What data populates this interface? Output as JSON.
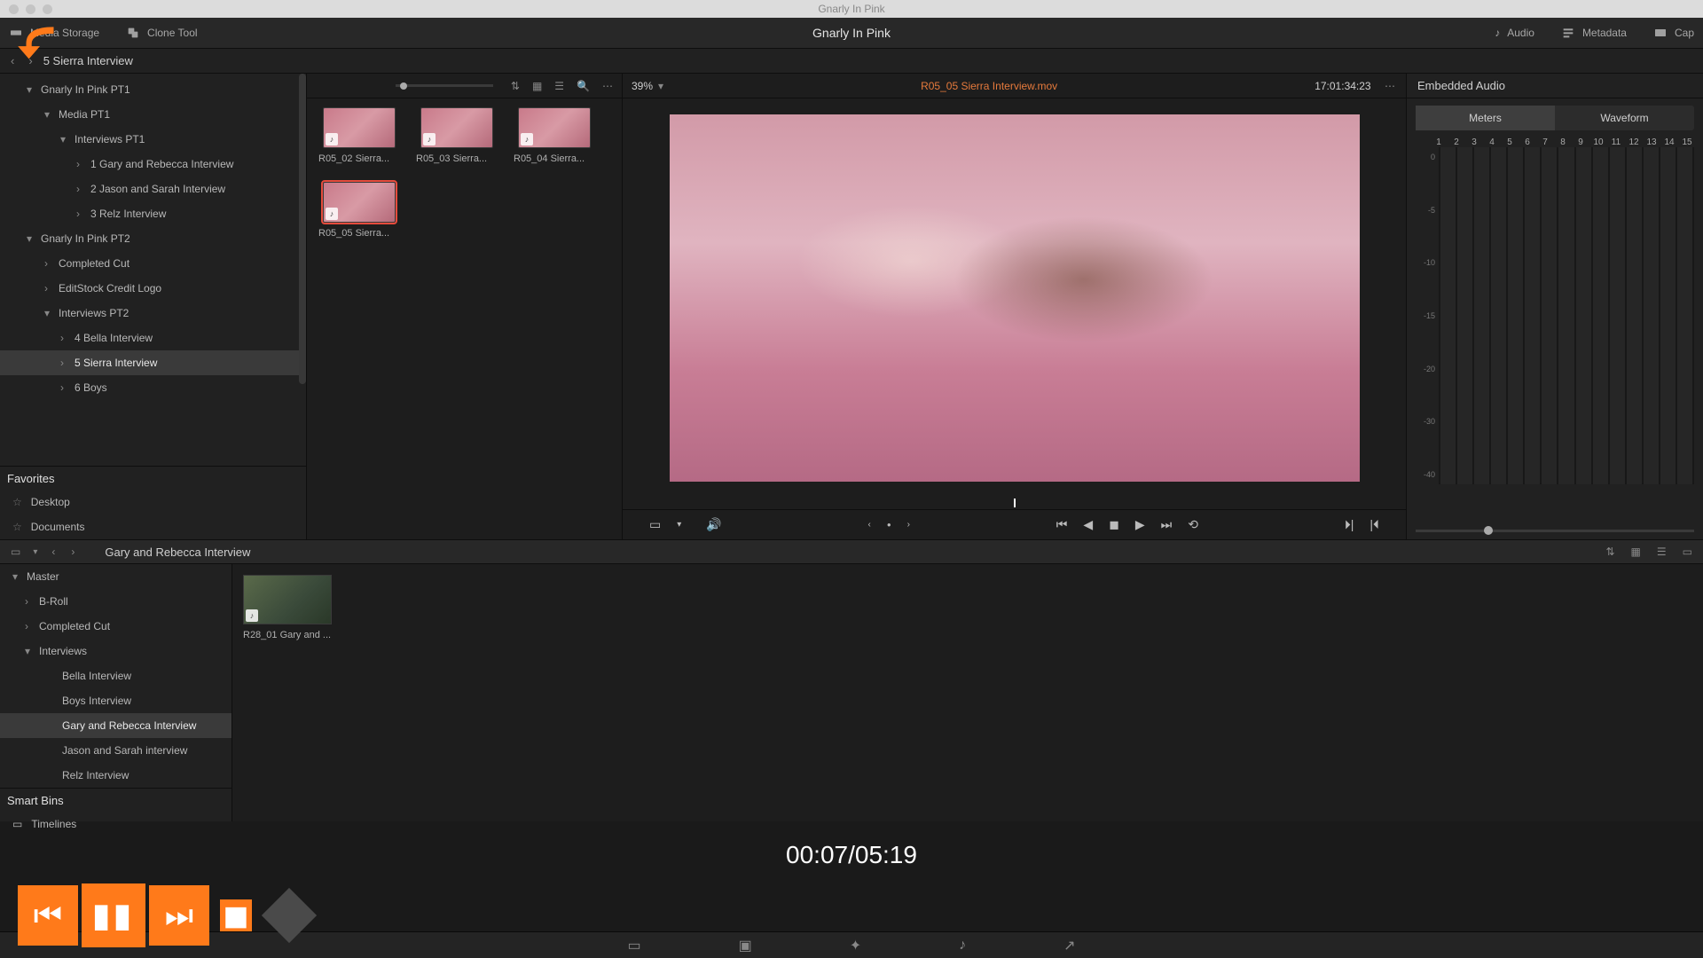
{
  "mac": {
    "title": "Gnarly In Pink"
  },
  "toolbar": {
    "media_storage": "Media Storage",
    "clone_tool": "Clone Tool",
    "project_title": "Gnarly In Pink",
    "audio": "Audio",
    "metadata": "Metadata",
    "capture": "Cap"
  },
  "breadcrumb": {
    "path": "5 Sierra Interview"
  },
  "tree": {
    "items": [
      {
        "label": "Gnarly In Pink PT1",
        "indent": 30,
        "arrow": "▾"
      },
      {
        "label": "Media PT1",
        "indent": 50,
        "arrow": "▾"
      },
      {
        "label": "Interviews PT1",
        "indent": 68,
        "arrow": "▾"
      },
      {
        "label": "1 Gary and Rebecca Interview",
        "indent": 86,
        "arrow": "›"
      },
      {
        "label": "2 Jason and Sarah Interview",
        "indent": 86,
        "arrow": "›"
      },
      {
        "label": "3 Relz Interview",
        "indent": 86,
        "arrow": "›"
      },
      {
        "label": "Gnarly In Pink PT2",
        "indent": 30,
        "arrow": "▾"
      },
      {
        "label": "Completed Cut",
        "indent": 50,
        "arrow": "›"
      },
      {
        "label": "EditStock Credit Logo",
        "indent": 50,
        "arrow": "›"
      },
      {
        "label": "Interviews PT2",
        "indent": 50,
        "arrow": "▾"
      },
      {
        "label": "4 Bella Interview",
        "indent": 68,
        "arrow": "›"
      },
      {
        "label": "5 Sierra Interview",
        "indent": 68,
        "arrow": "›",
        "selected": true
      },
      {
        "label": "6 Boys",
        "indent": 68,
        "arrow": "›"
      }
    ]
  },
  "favorites": {
    "header": "Favorites",
    "items": [
      "Desktop",
      "Documents"
    ]
  },
  "clips": [
    {
      "label": "R05_02 Sierra..."
    },
    {
      "label": "R05_03 Sierra..."
    },
    {
      "label": "R05_04 Sierra..."
    },
    {
      "label": "R05_05 Sierra...",
      "selected": true
    }
  ],
  "viewer": {
    "zoom": "39%",
    "clip_name": "R05_05 Sierra Interview.mov",
    "timecode": "17:01:34:23"
  },
  "audio": {
    "header": "Embedded Audio",
    "tabs": {
      "meters": "Meters",
      "waveform": "Waveform"
    },
    "channels": [
      "1",
      "2",
      "3",
      "4",
      "5",
      "6",
      "7",
      "8",
      "9",
      "10",
      "11",
      "12",
      "13",
      "14",
      "15"
    ],
    "db": [
      "0",
      "-5",
      "-10",
      "-15",
      "-20",
      "-30",
      "-40"
    ]
  },
  "pool": {
    "name": "Gary and Rebecca Interview"
  },
  "lower_tree": {
    "items": [
      {
        "label": "Master",
        "indent": 14,
        "arrow": "▾"
      },
      {
        "label": "B-Roll",
        "indent": 28,
        "arrow": "›"
      },
      {
        "label": "Completed Cut",
        "indent": 28,
        "arrow": "›"
      },
      {
        "label": "Interviews",
        "indent": 28,
        "arrow": "▾"
      },
      {
        "label": "Bella Interview",
        "indent": 54,
        "arrow": ""
      },
      {
        "label": "Boys Interview",
        "indent": 54,
        "arrow": ""
      },
      {
        "label": "Gary and Rebecca Interview",
        "indent": 54,
        "arrow": "",
        "selected": true
      },
      {
        "label": "Jason and Sarah interview",
        "indent": 54,
        "arrow": ""
      },
      {
        "label": "Relz Interview",
        "indent": 54,
        "arrow": ""
      }
    ]
  },
  "smartbins": {
    "header": "Smart Bins",
    "items": [
      "Timelines"
    ]
  },
  "lower_clip": {
    "label": "R28_01 Gary and ..."
  },
  "overlay": {
    "time": "00:07/05:19"
  }
}
